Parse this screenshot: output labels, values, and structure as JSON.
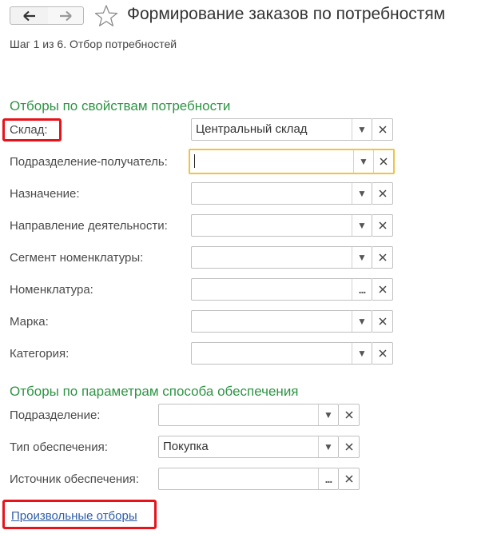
{
  "window": {
    "title": "Формирование заказов по потребностям",
    "step": "Шаг 1 из 6. Отбор потребностей"
  },
  "section1": {
    "title": "Отборы по свойствам потребности",
    "rows": [
      {
        "label": "Склад:",
        "value": "Центральный склад"
      },
      {
        "label": "Подразделение-получатель:",
        "value": ""
      },
      {
        "label": "Назначение:",
        "value": ""
      },
      {
        "label": "Направление деятельности:",
        "value": ""
      },
      {
        "label": "Сегмент номенклатуры:",
        "value": ""
      },
      {
        "label": "Номенклатура:",
        "value": ""
      },
      {
        "label": "Марка:",
        "value": ""
      },
      {
        "label": "Категория:",
        "value": ""
      }
    ]
  },
  "section2": {
    "title": "Отборы по параметрам способа обеспечения",
    "rows": [
      {
        "label": "Подразделение:",
        "value": ""
      },
      {
        "label": "Тип обеспечения:",
        "value": "Покупка"
      },
      {
        "label": "Источник обеспечения:",
        "value": ""
      }
    ]
  },
  "link": {
    "label": "Произвольные отборы"
  },
  "colors": {
    "section": "#2e9444",
    "highlight": "#e8121b",
    "focus": "#f0c247",
    "link": "#2f5ea6"
  },
  "icons": {
    "back": "arrow-left-icon",
    "forward": "arrow-right-icon",
    "favorite": "star-icon",
    "dropdown": "triangle-down-icon",
    "clear": "close-icon",
    "select": "ellipsis-icon"
  }
}
